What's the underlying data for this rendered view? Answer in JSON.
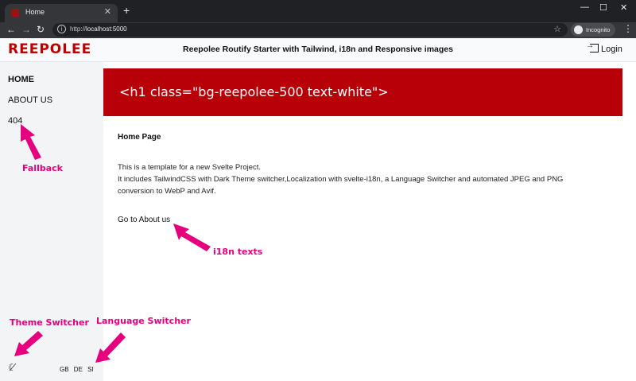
{
  "browser": {
    "tab_title": "Home",
    "tab_close": "✕",
    "new_tab": "+",
    "url_scheme": "http://",
    "url_host": "localhost:5000",
    "incognito_label": "Incognito",
    "window_minimize": "—",
    "window_maximize": "☐",
    "window_close": "✕"
  },
  "header": {
    "logo": "REEPOLEE",
    "title": "Reepolee Routify Starter with Tailwind, i18n and Responsive images",
    "login_label": "Login"
  },
  "sidebar": {
    "items": [
      {
        "label": "HOME"
      },
      {
        "label": "ABOUT US"
      },
      {
        "label": "404"
      }
    ]
  },
  "main": {
    "hero": "<h1 class=\"bg-reepolee-500 text-white\">",
    "heading": "Home Page",
    "paragraph_1": "This is a template for a new Svelte Project.",
    "paragraph_2": "It includes TailwindCSS with Dark Theme switcher,Localization with svelte-i18n, a Language Switcher and automated JPEG and PNG",
    "paragraph_3": "conversion to WebP and Avif.",
    "link": "Go to About us"
  },
  "footer": {
    "languages": [
      "GB",
      "DE",
      "SI"
    ]
  },
  "annotations": {
    "fallback": "Fallback",
    "i18n": "i18n texts",
    "theme": "Theme Switcher",
    "language": "Language Switcher"
  },
  "colors": {
    "brand": "#c00000",
    "hero_bg": "#b80008",
    "annotation": "#e6007e"
  }
}
